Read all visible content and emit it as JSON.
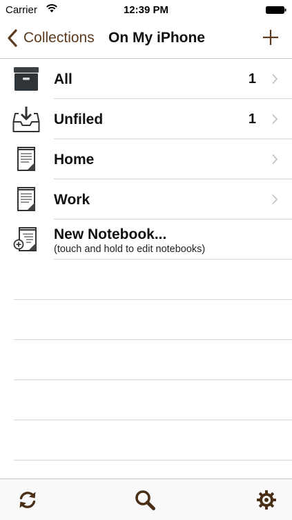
{
  "status_bar": {
    "carrier": "Carrier",
    "time": "12:39 PM",
    "icons": [
      "wifi-icon",
      "battery-icon"
    ]
  },
  "nav": {
    "back_label": "Collections",
    "title": "On My iPhone",
    "add_icon": "plus-icon"
  },
  "colors": {
    "accent": "#5b3a1e",
    "separator": "#d6d6da",
    "chevron": "#c7c7cc"
  },
  "collections": [
    {
      "label": "All",
      "count": "1",
      "icon": "archive-box-icon"
    },
    {
      "label": "Unfiled",
      "count": "1",
      "icon": "inbox-tray-icon"
    },
    {
      "label": "Home",
      "count": "",
      "icon": "notebook-icon"
    },
    {
      "label": "Work",
      "count": "",
      "icon": "notebook-icon"
    }
  ],
  "new_notebook": {
    "label": "New Notebook...",
    "hint": "(touch and hold to edit notebooks)",
    "icon": "new-notebook-icon"
  },
  "toolbar": {
    "icons": [
      "sync-icon",
      "search-icon",
      "settings-gear-icon"
    ]
  }
}
